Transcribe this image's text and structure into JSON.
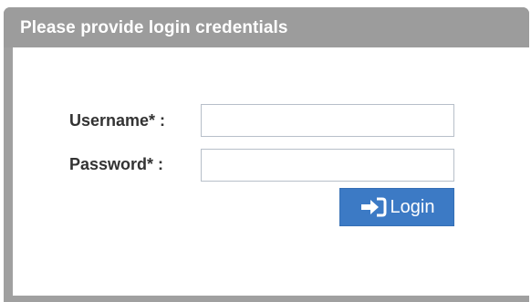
{
  "dialog": {
    "title": "Please provide login credentials"
  },
  "form": {
    "username_label": "Username* :",
    "username_value": "",
    "password_label": "Password* :",
    "password_value": "",
    "login_label": "Login",
    "login_icon": "sign-in-icon"
  },
  "colors": {
    "header_bg": "#9c9c9c",
    "button_bg": "#3c7ac5",
    "label_text": "#333333"
  }
}
